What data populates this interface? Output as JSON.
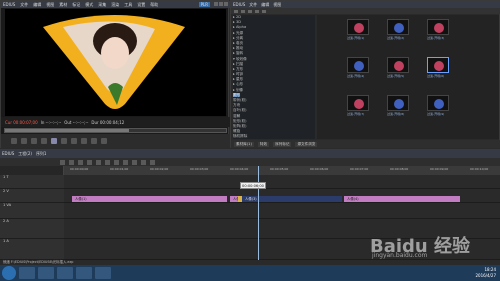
{
  "player": {
    "app_name": "EDIUS",
    "menu": [
      "文件",
      "编辑",
      "视图",
      "素材",
      "标记",
      "模式",
      "采集",
      "渲染",
      "工具",
      "设置",
      "帮助"
    ],
    "badge": "PLR",
    "timecode_cur": "Cur 00:00:07;00",
    "in_label": "In --:--:--;--",
    "out_label": "Out --:--:--;--",
    "dur_label": "Dur 00:00:04;12",
    "scrub_progress": 0.56
  },
  "bin": {
    "title": "EDIUS",
    "menu": [
      "文件",
      "编辑",
      "视图"
    ],
    "tree": [
      "▸ 2D",
      "▸ 3D",
      "▸ Alpha",
      "▸ 光源",
      "▸ 分离",
      "▸ 卷页",
      "▸ 推动",
      "▸ 旋转",
      "▾ 软划像",
      "▸ 扫描",
      "  ▸ 方形",
      "  ▸ 时钟",
      "  ▸ 星形",
      "  ▸ 心形",
      "▸ 划像",
      "  圆形",
      "  带状(软)",
      "  方块",
      "  百叶(软)",
      "  溶解",
      "  矩形(软)",
      "  矩阵(软)",
      "  螺旋",
      "  随机擦除"
    ],
    "selected_tree_index": 15,
    "thumbs": [
      {
        "label": "过渡-开场(1)",
        "color": "#c04060"
      },
      {
        "label": "过渡-开场(2)",
        "color": "#4060c0"
      },
      {
        "label": "过渡-开场(3)",
        "color": "#c04060"
      },
      {
        "label": "过渡-开场(4)",
        "color": "#4060c0"
      },
      {
        "label": "过渡-开场(5)",
        "color": "#c04060"
      },
      {
        "label": "过渡-开场(6)",
        "color": "#c04060"
      },
      {
        "label": "过渡-开场(7)",
        "color": "#c04060"
      },
      {
        "label": "过渡-开场(8)",
        "color": "#4060c0"
      },
      {
        "label": "过渡-开场(9)",
        "color": "#4060c0"
      }
    ],
    "tabs": [
      "素材库(1)",
      "特效",
      "序列标记",
      "源文件浏览"
    ]
  },
  "timeline": {
    "title": "EDIUS",
    "menu_label": "工程(2)",
    "sequence_label": "序列1",
    "tracks": [
      {
        "label": "1 T"
      },
      {
        "label": "2 V"
      },
      {
        "label": "1 VA"
      },
      {
        "label": "2 A"
      },
      {
        "label": "1 A"
      }
    ],
    "ruler_ticks": [
      "00:00:00;00",
      "00:00:01;00",
      "00:00:02;00",
      "00:00:03;00",
      "00:00:04;00",
      "00:00:05;00",
      "00:00:06;00",
      "00:00:07;00",
      "00:00:08;00",
      "00:00:09;00",
      "00:00:10;00"
    ],
    "popup_tc": "00:00:06;00",
    "clips": [
      {
        "label": "人像(1)",
        "kind": "pink"
      },
      {
        "label": "人像(2)",
        "kind": "pink"
      },
      {
        "label": "",
        "kind": "gold"
      },
      {
        "label": "人像(3)",
        "kind": "blue"
      },
      {
        "label": "人像(4)",
        "kind": "pink"
      }
    ]
  },
  "status": "就绪",
  "status_path": "F:\\EDIUS\\Project\\EDIUS6\\光标插入.ezp",
  "tray": {
    "time": "18:24",
    "date": "2016/4/27"
  },
  "watermark": {
    "main": "Baidu 经验",
    "sub": "jingyan.baidu.com"
  }
}
